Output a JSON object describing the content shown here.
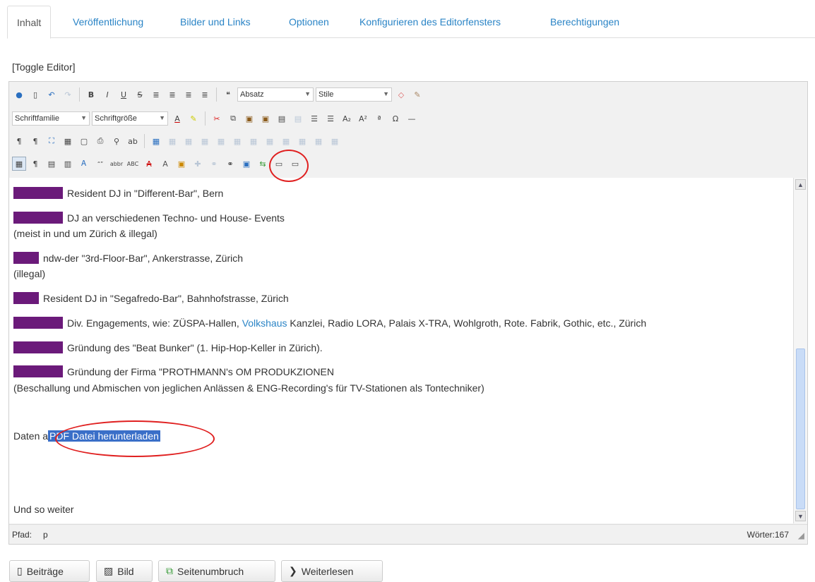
{
  "tabs": [
    {
      "label": "Inhalt",
      "active": true
    },
    {
      "label": "Veröffentlichung"
    },
    {
      "label": "Bilder und Links"
    },
    {
      "label": "Optionen"
    },
    {
      "label": "Konfigurieren des Editorfensters"
    },
    {
      "label": "Berechtigungen"
    }
  ],
  "toggle_editor": "[Toggle Editor]",
  "toolbar": {
    "format_select": "Absatz",
    "style_select": "Stile",
    "font_family_select": "Schriftfamilie",
    "font_size_select": "Schriftgröße"
  },
  "content": {
    "p1": "Resident DJ in \"Different-Bar\", Bern",
    "p2a": "DJ an verschiedenen Techno- und House- Events",
    "p2b": "(meist in und um Zürich & illegal)",
    "p3a": "ndw-der \"3rd-Floor-Bar\", Ankerstrasse, Zürich",
    "p3b": "(illegal)",
    "p4": "Resident DJ in \"Segafredo-Bar\", Bahnhofstrasse, Zürich",
    "p5_pre": "Div. Engagements, wie: ZÜSPA-Hallen,",
    "p5_link": "Volkshaus",
    "p5_post": "Kanzlei, Radio LORA, Palais X-TRA, Wohlgroth, Rote. Fabrik, Gothic, etc., Zürich",
    "p6": "Gründung des \"Beat Bunker\" (1. Hip-Hop-Keller in Zürich).",
    "p7a": "Gründung der Firma \"PROTHMANN's OM PRODUKZIONEN",
    "p7b": "(Beschallung und Abmischen von jeglichen Anlässen & ENG-Recording's für TV-Stationen als Tontechniker)",
    "daten_pre": "Daten a",
    "daten_link": "PDF Datei herunterladen",
    "und_so_weiter": "Und so weiter"
  },
  "status": {
    "path_label": "Pfad:",
    "path_value": "p",
    "word_count": "Wörter:167"
  },
  "bottom_buttons": {
    "beitraege": "Beiträge",
    "bild": "Bild",
    "seitenumbruch": "Seitenumbruch",
    "weiterlesen": "Weiterlesen"
  },
  "colors": {
    "link_blue": "#2a84c6",
    "year_block": "#6b1a7a",
    "highlight_circle": "#e02020",
    "selection": "#3a6fc8"
  }
}
